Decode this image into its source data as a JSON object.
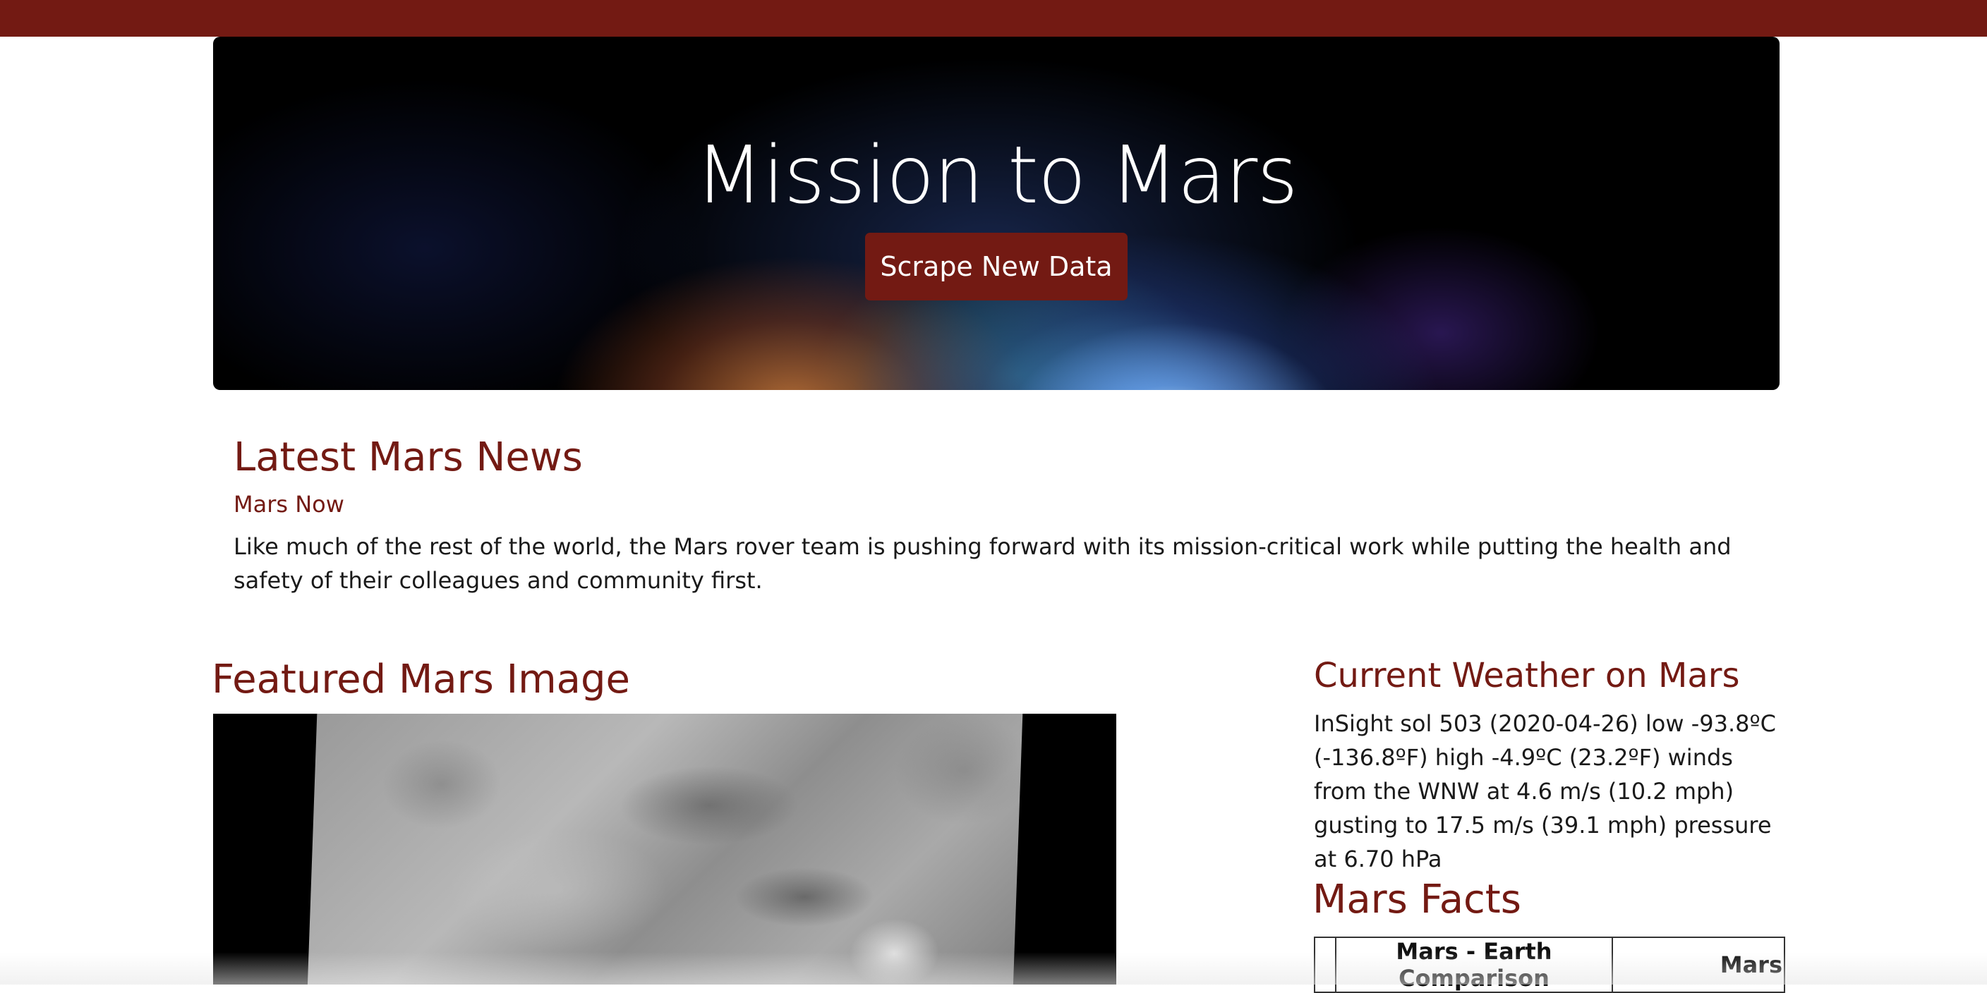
{
  "hero": {
    "title": "Mission to Mars",
    "button_label": "Scrape New Data"
  },
  "news": {
    "heading": "Latest Mars News",
    "article_title": "Mars Now",
    "article_body": "Like much of the rest of the world, the Mars rover team is pushing forward with its mission-critical work while putting the health and safety of their colleagues and community first."
  },
  "featured_image": {
    "heading": "Featured Mars Image"
  },
  "weather": {
    "heading": "Current Weather on Mars",
    "report": "InSight sol 503 (2020-04-26) low -93.8ºC (-136.8ºF) high -4.9ºC (23.2ºF) winds from the WNW at 4.6 m/s (10.2 mph) gusting to 17.5 m/s (39.1 mph) pressure at 6.70 hPa"
  },
  "facts": {
    "heading": "Mars Facts",
    "table": {
      "headers": [
        "",
        "Mars - Earth Comparison",
        "Mars"
      ]
    }
  },
  "colors": {
    "brand": "#731a13",
    "hero_background": "#000000",
    "page_background": "#ffffff"
  }
}
